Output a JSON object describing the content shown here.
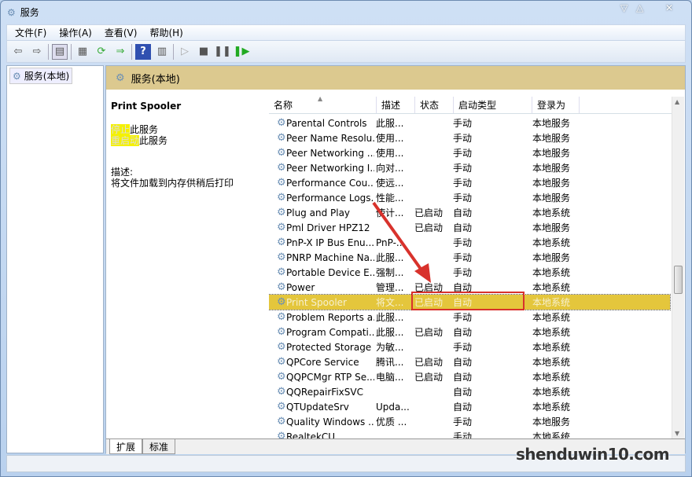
{
  "window": {
    "title": "服务",
    "controls": [
      "minimize",
      "maximize",
      "close"
    ]
  },
  "menu": [
    "文件(F)",
    "操作(A)",
    "查看(V)",
    "帮助(H)"
  ],
  "toolbar": [
    "back-icon",
    "forward-icon",
    "show-hide-tree-icon",
    "properties-icon",
    "refresh-icon",
    "export-icon",
    "help-icon",
    "console-icon",
    "start-icon",
    "stop-icon",
    "pause-icon",
    "restart-icon"
  ],
  "tree": {
    "item": "服务(本地)"
  },
  "band": {
    "title": "服务(本地)"
  },
  "detail": {
    "name": "Print Spooler",
    "stop_link": "停止",
    "stop_rest": "此服务",
    "restart_link": "重启动",
    "restart_rest": "此服务",
    "desc_label": "描述:",
    "desc": "将文件加载到内存供稍后打印"
  },
  "columns": [
    "名称",
    "描述",
    "状态",
    "启动类型",
    "登录为"
  ],
  "rows": [
    [
      "Parental Controls",
      "此服...",
      "",
      "手动",
      "本地服务"
    ],
    [
      "Peer Name Resolu...",
      "使用...",
      "",
      "手动",
      "本地服务"
    ],
    [
      "Peer Networking ...",
      "使用...",
      "",
      "手动",
      "本地服务"
    ],
    [
      "Peer Networking I...",
      "向对...",
      "",
      "手动",
      "本地服务"
    ],
    [
      "Performance Cou...",
      "使远...",
      "",
      "手动",
      "本地服务"
    ],
    [
      "Performance Logs...",
      "性能...",
      "",
      "手动",
      "本地服务"
    ],
    [
      "Plug and Play",
      "使计...",
      "已启动",
      "自动",
      "本地系统"
    ],
    [
      "Pml Driver HPZ12",
      "",
      "已启动",
      "自动",
      "本地服务"
    ],
    [
      "PnP-X IP Bus Enu...",
      "PnP-...",
      "",
      "手动",
      "本地系统"
    ],
    [
      "PNRP Machine Na...",
      "此服...",
      "",
      "手动",
      "本地服务"
    ],
    [
      "Portable Device E...",
      "强制...",
      "",
      "手动",
      "本地系统"
    ],
    [
      "Power",
      "管理...",
      "已启动",
      "自动",
      "本地系统"
    ],
    [
      "Print Spooler",
      "将文...",
      "已启动",
      "自动",
      "本地系统"
    ],
    [
      "Problem Reports a...",
      "此服...",
      "",
      "手动",
      "本地系统"
    ],
    [
      "Program Compati...",
      "此服...",
      "已启动",
      "自动",
      "本地系统"
    ],
    [
      "Protected Storage",
      "为敏...",
      "",
      "手动",
      "本地系统"
    ],
    [
      "QPCore Service",
      "腾讯...",
      "已启动",
      "自动",
      "本地系统"
    ],
    [
      "QQPCMgr RTP Se...",
      "电脑...",
      "已启动",
      "自动",
      "本地系统"
    ],
    [
      "QQRepairFixSVC",
      "",
      "",
      "自动",
      "本地系统"
    ],
    [
      "QTUpdateSrv",
      "Upda...",
      "",
      "自动",
      "本地系统"
    ],
    [
      "Quality Windows ...",
      "优质 ...",
      "",
      "手动",
      "本地服务"
    ],
    [
      "RealtekCU",
      "",
      "",
      "手动",
      "本地系统"
    ]
  ],
  "selected_row": 12,
  "tabs": [
    "扩展",
    "标准"
  ],
  "watermark": "shenduwin10.com",
  "colors": {
    "band": "#dcc98f",
    "selection": "#e4c63c",
    "highlight_box": "#d8322c"
  }
}
